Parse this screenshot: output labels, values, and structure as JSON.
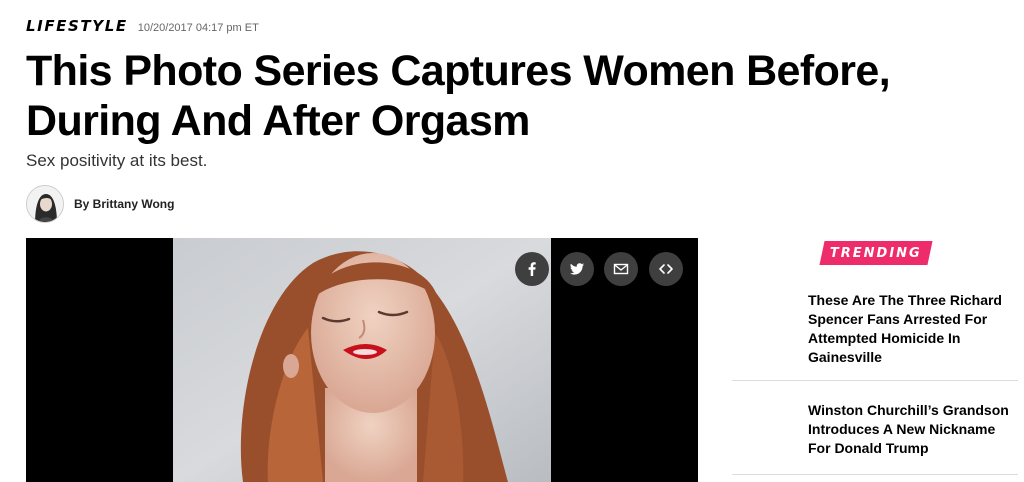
{
  "article": {
    "section": "LIFESTYLE",
    "timestamp": "10/20/2017 04:17 pm ET",
    "headline_line1": "This Photo Series Captures Women Before,",
    "headline_line2": "During And After Orgasm",
    "dek": "Sex positivity at its best.",
    "byline": "By Brittany Wong"
  },
  "share_buttons": [
    {
      "icon": "facebook-icon"
    },
    {
      "icon": "twitter-icon"
    },
    {
      "icon": "email-icon"
    },
    {
      "icon": "embed-icon"
    }
  ],
  "sidebar": {
    "trending_label": "TRENDING",
    "items": [
      {
        "title": "These Are The Three Richard Spencer Fans Arrested For Attempted Homicide In Gainesville"
      },
      {
        "title": "Winston Churchill’s Grandson Introduces A New Nickname For Donald Trump"
      }
    ]
  },
  "colors": {
    "accent": "#ef2c6b",
    "share_button_bg": "#3f3f3f",
    "media_bg": "#000000"
  }
}
